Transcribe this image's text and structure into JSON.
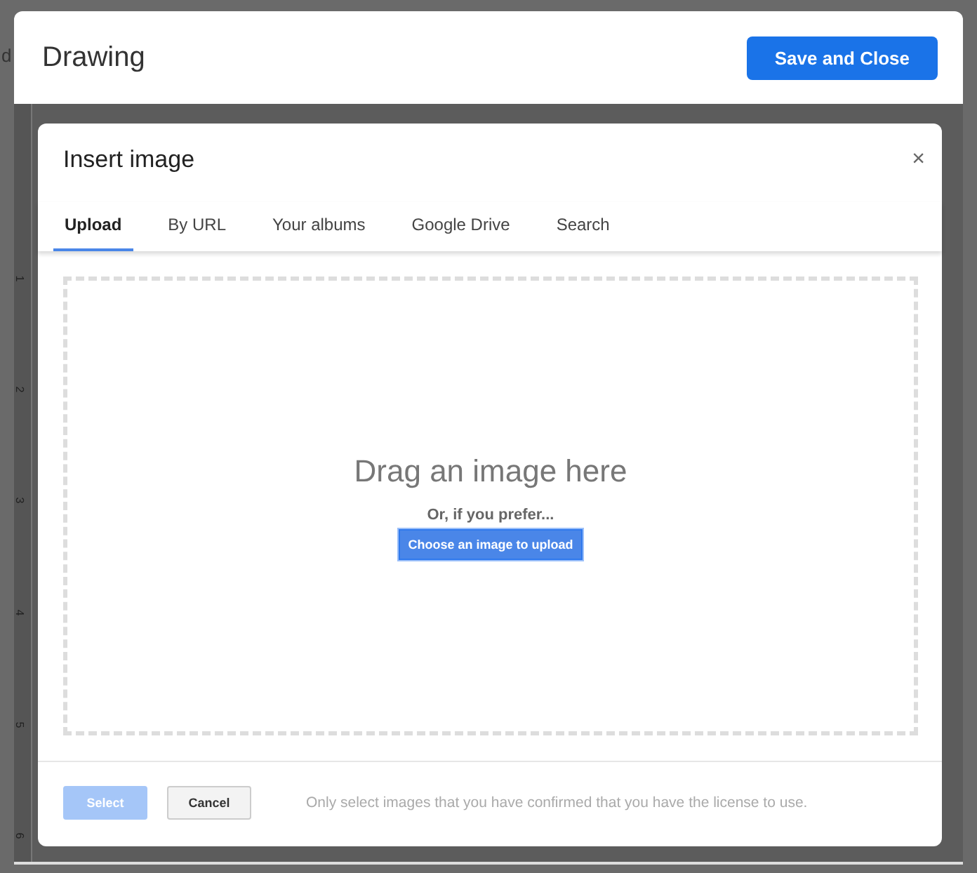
{
  "background": {
    "cut_text": "d",
    "ruler": [
      "1",
      "2",
      "3",
      "4",
      "5",
      "6"
    ]
  },
  "drawing": {
    "title": "Drawing",
    "save_button": "Save and Close"
  },
  "dialog": {
    "title": "Insert image",
    "close": "×",
    "tabs": [
      {
        "label": "Upload",
        "selected": true
      },
      {
        "label": "By URL",
        "selected": false
      },
      {
        "label": "Your albums",
        "selected": false
      },
      {
        "label": "Google Drive",
        "selected": false
      },
      {
        "label": "Search",
        "selected": false
      }
    ],
    "drop_zone": {
      "heading": "Drag an image here",
      "subtext": "Or, if you prefer...",
      "button": "Choose an image to upload"
    },
    "footer": {
      "buttons": [
        {
          "label": "Select",
          "disabled": true
        },
        {
          "label": "Cancel",
          "disabled": false
        }
      ],
      "note": "Only select images that you have confirmed that you have the license to use."
    }
  }
}
